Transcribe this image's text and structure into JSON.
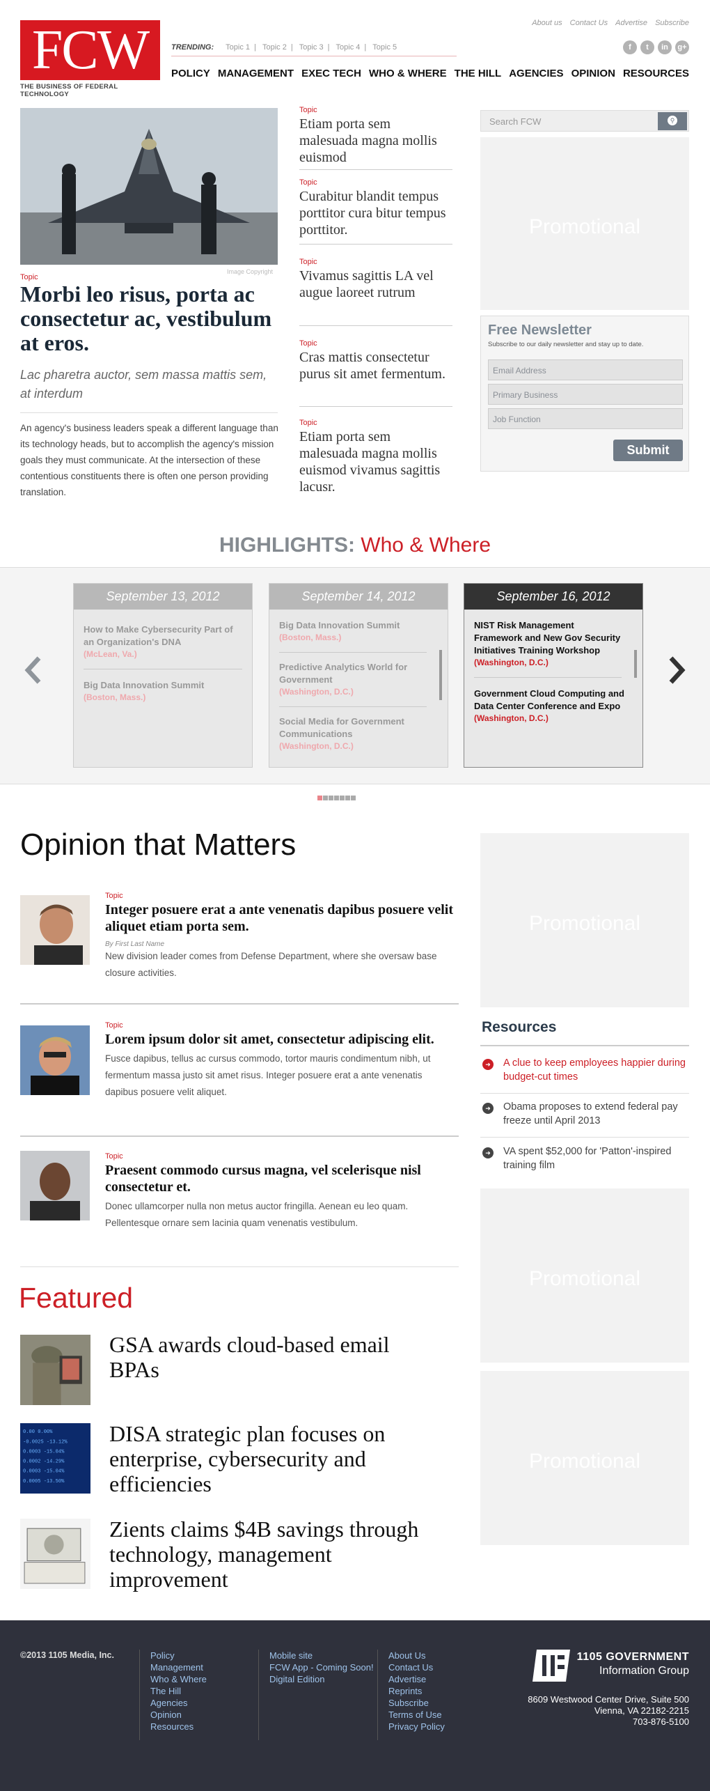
{
  "site": {
    "logo_text": "FCW",
    "tagline": "THE BUSINESS OF FEDERAL TECHNOLOGY"
  },
  "utility_links": [
    "About us",
    "Contact Us",
    "Advertise",
    "Subscribe"
  ],
  "trending": {
    "label": "TRENDING:",
    "topics": [
      "Topic 1",
      "Topic 2",
      "Topic 3",
      "Topic 4",
      "Topic 5"
    ],
    "separator": "|"
  },
  "social": [
    "f",
    "t",
    "in",
    "g+"
  ],
  "nav": [
    "POLICY",
    "MANAGEMENT",
    "EXEC TECH",
    "WHO & WHERE",
    "THE HILL",
    "AGENCIES",
    "OPINION",
    "RESOURCES"
  ],
  "lead": {
    "image_credit": "Image Copyright",
    "topic": "Topic",
    "title": "Morbi leo risus, porta ac consectetur ac, vestibulum at eros.",
    "deck": "Lac pharetra auctor, sem massa mattis sem, at interdum",
    "body": "An agency's business leaders speak a different language than its technology heads, but to accomplish the agency's mission goals they must communicate. At the intersection of these contentious constituents there is often one person providing translation."
  },
  "mid_stories": [
    {
      "topic": "Topic",
      "title": "Etiam porta sem malesuada magna mollis euismod"
    },
    {
      "topic": "Topic",
      "title": "Curabitur blandit tempus porttitor cura bitur tempus porttitor."
    },
    {
      "topic": "Topic",
      "title": "Vivamus sagittis LA vel augue laoreet rutrum"
    },
    {
      "topic": "Topic",
      "title": "Cras mattis consectetur purus sit amet fermentum."
    },
    {
      "topic": "Topic",
      "title": "Etiam porta sem malesuada magna mollis euismod vivamus sagittis lacusr."
    }
  ],
  "search": {
    "placeholder": "Search FCW",
    "icon": "search-icon"
  },
  "promo_label": "Promotional",
  "newsletter": {
    "title": "Free Newsletter",
    "subtitle": "Subscribe to our daily newsletter and stay up to date.",
    "fields": [
      "Email Address",
      "Primary Business",
      "Job Function"
    ],
    "submit": "Submit"
  },
  "highlights": {
    "prefix": "HIGHLIGHTS:",
    "section": "Who & Where",
    "cards": [
      {
        "date": "September 13, 2012",
        "events": [
          {
            "name": "How to Make Cybersecurity Part of an Organization's DNA",
            "loc": "(McLean, Va.)"
          },
          {
            "name": "Big Data Innovation Summit",
            "loc": "(Boston, Mass.)"
          }
        ]
      },
      {
        "date": "September 14, 2012",
        "events": [
          {
            "name": "Big Data Innovation Summit",
            "loc": "(Boston, Mass.)"
          },
          {
            "name": "Predictive Analytics World for Government",
            "loc": "(Washington, D.C.)"
          },
          {
            "name": "Social Media for Government Communications",
            "loc": "(Washington, D.C.)"
          }
        ]
      },
      {
        "date": "September 16, 2012",
        "events": [
          {
            "name": "NIST Risk Management Framework and New Gov Security Initiatives Training Workshop",
            "loc": "(Washington, D.C.)"
          },
          {
            "name": "Government Cloud Computing and Data Center Conference and Expo",
            "loc": "(Washington, D.C.)"
          }
        ]
      }
    ],
    "active_dot": 1,
    "dot_count": 7
  },
  "opinion": {
    "title": "Opinion that Matters",
    "items": [
      {
        "topic": "Topic",
        "title": "Integer posuere erat a ante venenatis dapibus posuere velit aliquet etiam porta sem.",
        "byline": "By First Last Name",
        "summary": "New division leader comes from Defense Department, where she oversaw base closure activities."
      },
      {
        "topic": "Topic",
        "title": "Lorem ipsum dolor sit amet, consectetur adipiscing elit.",
        "byline": "",
        "summary": "Fusce dapibus, tellus ac cursus commodo, tortor mauris condimentum nibh, ut fermentum massa justo sit amet risus. Integer posuere erat a ante venenatis dapibus posuere velit aliquet."
      },
      {
        "topic": "Topic",
        "title": "Praesent commodo cursus magna, vel scelerisque nisl consectetur et.",
        "byline": "",
        "summary": "Donec ullamcorper nulla non metus auctor fringilla. Aenean eu leo quam. Pellentesque ornare sem lacinia quam venenatis vestibulum."
      }
    ]
  },
  "resources": {
    "title": "Resources",
    "items": [
      {
        "text": "A clue to keep employees happier during budget-cut times",
        "highlight": true
      },
      {
        "text": "Obama proposes to extend federal pay freeze until April 2013",
        "highlight": false
      },
      {
        "text": "VA spent $52,000 for 'Patton'-inspired training film",
        "highlight": false
      }
    ]
  },
  "featured": {
    "title": "Featured",
    "items": [
      {
        "title": "GSA awards cloud-based email BPAs"
      },
      {
        "title": "DISA strategic plan focuses on enterprise, cybersecurity and efficiencies"
      },
      {
        "title": "Zients claims $4B savings through technology, management improvement"
      }
    ]
  },
  "footer": {
    "copyright": "©2013 1105 Media, Inc.",
    "col1": [
      "Policy",
      "Management",
      "Who & Where",
      "The Hill",
      "Agencies",
      "Opinion",
      "Resources"
    ],
    "col2": [
      "Mobile site",
      "FCW App - Coming Soon!",
      "Digital Edition"
    ],
    "col3": [
      "About Us",
      "Contact Us",
      "Advertise",
      "Reprints",
      "Subscribe",
      "Terms of Use",
      "Privacy Policy"
    ],
    "brand_line1": "1105 GOVERNMENT",
    "brand_line2": "Information Group",
    "address": [
      "8609 Westwood Center Drive, Suite 500",
      "Vienna, VA 22182-2215",
      "703-876-5100"
    ]
  },
  "colors": {
    "brand_red": "#cc1f26",
    "logo_red": "#d71921",
    "slate": "#6f7a86",
    "footer_bg": "#2f313c"
  }
}
